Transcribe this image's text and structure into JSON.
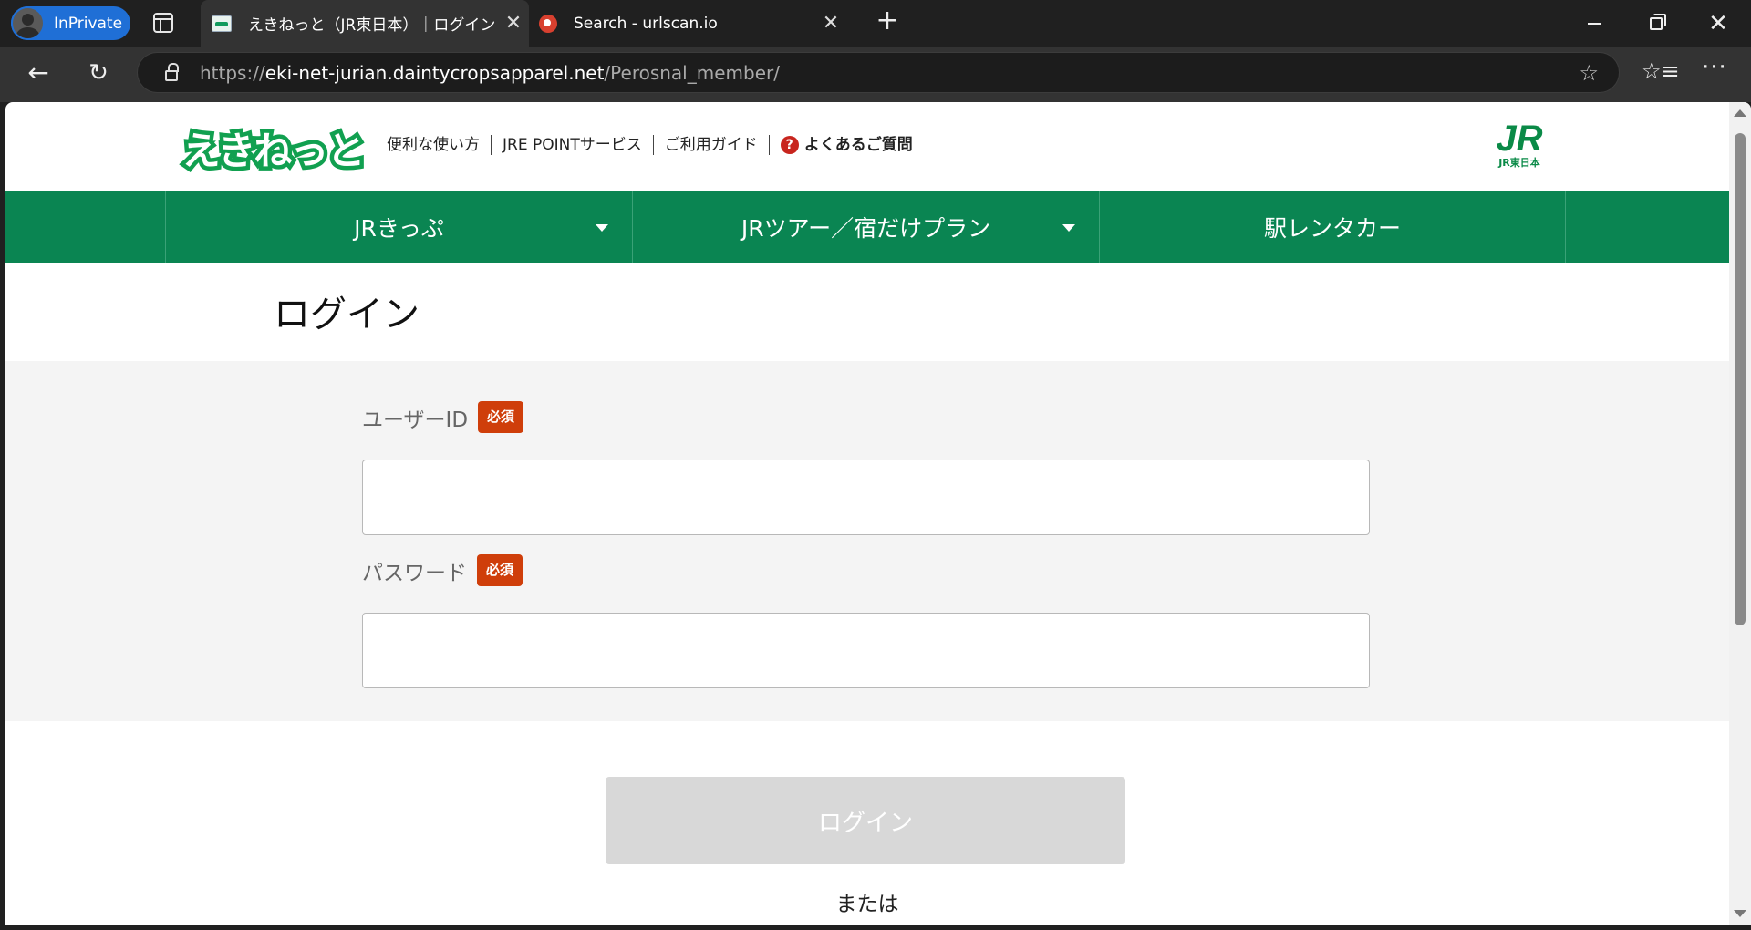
{
  "browser": {
    "inprivate_label": "InPrivate",
    "tabs": [
      {
        "title": "えきねっと（JR東日本）｜ログイン"
      },
      {
        "title": "Search - urlscan.io"
      }
    ],
    "url": {
      "scheme": "https://",
      "host": "eki-net-jurian.daintycropsapparel.net",
      "path": "/Perosnal_member/"
    },
    "icons": {
      "back": "←",
      "reload": "↻",
      "star": "☆",
      "favorites": "☆≡",
      "more": "···",
      "close": "✕",
      "new_tab": "+"
    }
  },
  "site": {
    "logo_text": "えきねっと",
    "header_links": [
      {
        "label": "便利な使い方"
      },
      {
        "label": "JRE POINTサービス"
      },
      {
        "label": "ご利用ガイド"
      }
    ],
    "faq": {
      "icon": "?",
      "label": "よくあるご質問"
    },
    "jr_logo": {
      "mark": "JR",
      "sub": "JR東日本"
    },
    "nav": [
      {
        "label": "JRきっぷ"
      },
      {
        "label": "JRツアー／宿だけプラン"
      },
      {
        "label": "駅レンタカー"
      }
    ],
    "colors": {
      "brand_green": "#0a8552",
      "required_badge": "#cf3e0a"
    }
  },
  "login": {
    "title": "ログイン",
    "user_id": {
      "label": "ユーザーID",
      "required": "必須",
      "value": ""
    },
    "password": {
      "label": "パスワード",
      "required": "必須",
      "value": ""
    },
    "submit_label": "ログイン",
    "or_label": "または"
  }
}
